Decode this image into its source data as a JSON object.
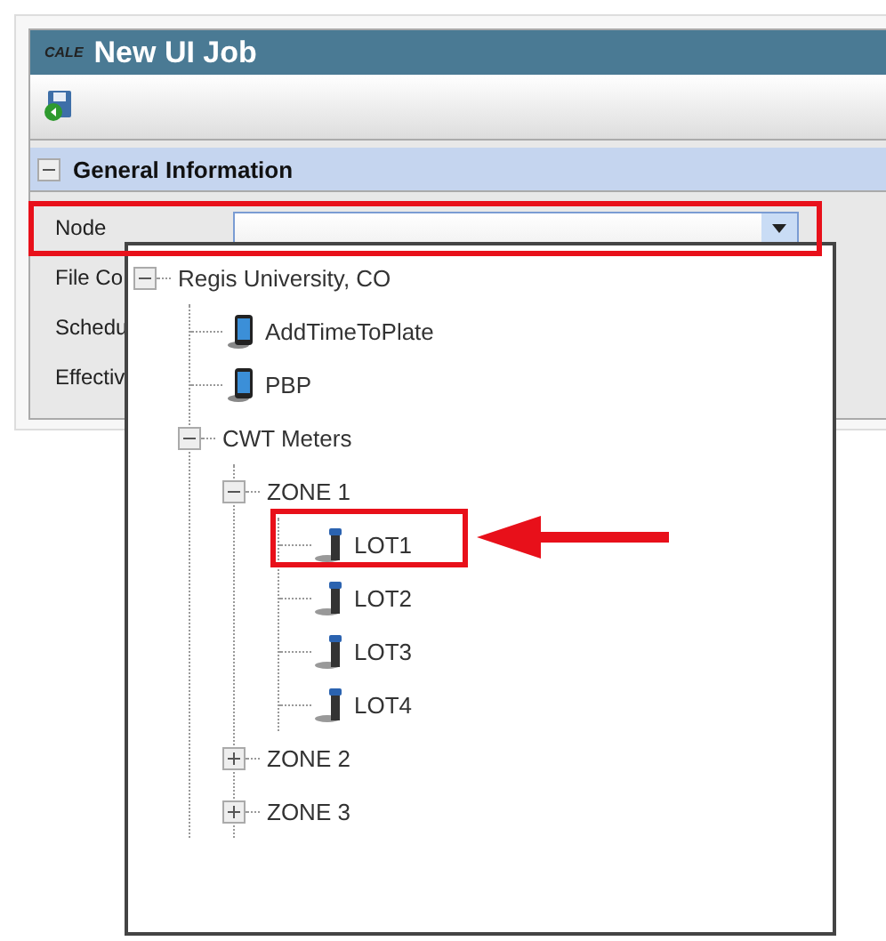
{
  "window": {
    "logo": "CALE",
    "title": "New UI Job"
  },
  "section": {
    "title": "General Information",
    "expanded": true
  },
  "form": {
    "fields": [
      {
        "label": "Node",
        "kind": "dropdown"
      },
      {
        "label": "File Co",
        "kind": "hidden"
      },
      {
        "label": "Schedu",
        "kind": "hidden"
      },
      {
        "label": "Effectiv",
        "kind": "hidden"
      }
    ]
  },
  "tree": [
    {
      "label": "Regis University, CO",
      "kind": "folder",
      "expanded": true,
      "children": [
        {
          "label": "AddTimeToPlate",
          "kind": "phone"
        },
        {
          "label": "PBP",
          "kind": "phone"
        },
        {
          "label": "CWT Meters",
          "kind": "folder",
          "expanded": true,
          "children": [
            {
              "label": "ZONE 1",
              "kind": "folder",
              "expanded": true,
              "children": [
                {
                  "label": "LOT1",
                  "kind": "meter"
                },
                {
                  "label": "LOT2",
                  "kind": "meter"
                },
                {
                  "label": "LOT3",
                  "kind": "meter"
                },
                {
                  "label": "LOT4",
                  "kind": "meter"
                }
              ]
            },
            {
              "label": "ZONE 2",
              "kind": "folder",
              "expanded": false
            },
            {
              "label": "ZONE 3",
              "kind": "folder",
              "expanded": false
            }
          ]
        }
      ]
    }
  ]
}
